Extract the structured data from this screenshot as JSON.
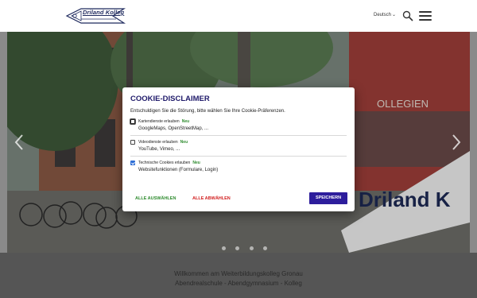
{
  "header": {
    "logo_text": "Driland Kolleg",
    "language": "Deutsch"
  },
  "hero": {
    "sign_text": "Driland K",
    "sign_text_top": "OLLEGIEN",
    "slide_count": 4
  },
  "cookie_dialog": {
    "title": "COOKIE-DISCLAIMER",
    "intro": "Entschuldigen Sie die Störung, bitte wählen Sie Ihre Cookie-Präferenzen.",
    "options": [
      {
        "label": "Kartendienste erlauben",
        "badge": "Neu",
        "description": "GoogleMaps, OpenStreetMap, ...",
        "checked": false
      },
      {
        "label": "Videodienste erlauben",
        "badge": "Neu",
        "description": "YouTube, Vimeo, ...",
        "checked": false
      },
      {
        "label": "Technische Cookies erlauben",
        "badge": "Neu",
        "description": "Websitefunktionen (Formulare, Login)",
        "checked": true
      }
    ],
    "select_all_label": "ALLE AUSWÄHLEN",
    "deselect_all_label": "ALLE ABWÄHLEN",
    "save_label": "SPEICHERN",
    "colors": {
      "title": "#1f1a6a",
      "select_all": "#2e8b2e",
      "deselect_all": "#d22020",
      "save_bg": "#2d1d9c",
      "badge": "#2e8b2e"
    }
  },
  "footer": {
    "line1": "Willkommen am Weiterbildungskolleg Gronau",
    "line2": "Abendrealschule - Abendgymnasium - Kolleg"
  }
}
